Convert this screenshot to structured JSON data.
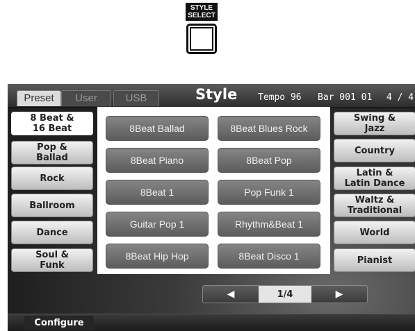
{
  "hardware": {
    "label_line1": "STYLE",
    "label_line2": "SELECT"
  },
  "tabs": [
    {
      "label": "Preset",
      "active": true
    },
    {
      "label": "User",
      "active": false
    },
    {
      "label": "USB",
      "active": false
    }
  ],
  "header": {
    "title": "Style",
    "tempo": "Tempo 96",
    "bar": "Bar 001 01",
    "time_sig": "4 / 4"
  },
  "left_categories": [
    {
      "label": "8 Beat &\n16 Beat",
      "active": true
    },
    {
      "label": "Pop &\nBallad",
      "active": false
    },
    {
      "label": "Rock",
      "active": false
    },
    {
      "label": "Ballroom",
      "active": false
    },
    {
      "label": "Dance",
      "active": false
    },
    {
      "label": "Soul &\nFunk",
      "active": false
    }
  ],
  "right_categories": [
    {
      "label": "Swing &\nJazz"
    },
    {
      "label": "Country"
    },
    {
      "label": "Latin &\nLatin Dance"
    },
    {
      "label": "Waltz &\nTraditional"
    },
    {
      "label": "World"
    },
    {
      "label": "Pianist"
    }
  ],
  "styles": [
    "8Beat Ballad",
    "8Beat Blues Rock",
    "8Beat Piano",
    "8Beat Pop",
    "8Beat 1",
    "Pop Funk 1",
    "Guitar Pop 1",
    "Rhythm&Beat 1",
    "8Beat Hip Hop",
    "8Beat Disco 1"
  ],
  "pager": {
    "prev": "◀",
    "page": "1/4",
    "next": "▶"
  },
  "footer": {
    "configure": "Configure"
  }
}
